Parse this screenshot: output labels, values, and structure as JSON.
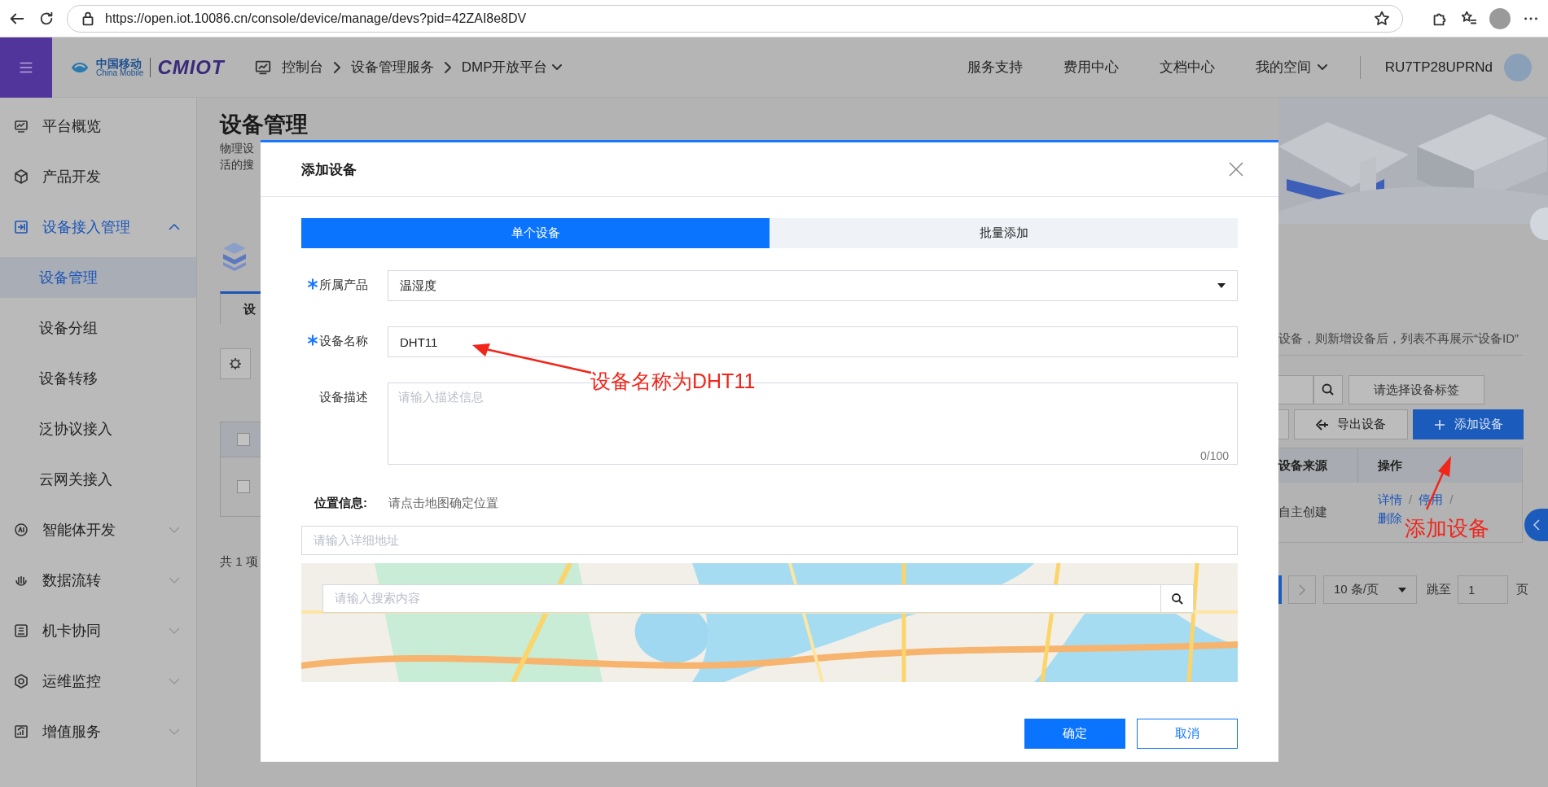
{
  "browser": {
    "url": "https://open.iot.10086.cn/console/device/manage/devs?pid=42ZAI8e8DV"
  },
  "header": {
    "logo": {
      "cn": "中国移动",
      "en": "China Mobile",
      "brand": "CMIOT"
    },
    "breadcrumb": [
      {
        "label": "控制台",
        "dropdown": false
      },
      {
        "label": "设备管理服务",
        "dropdown": false
      },
      {
        "label": "DMP开放平台",
        "dropdown": true
      }
    ],
    "nav": [
      {
        "label": "服务支持",
        "dropdown": false
      },
      {
        "label": "费用中心",
        "dropdown": false
      },
      {
        "label": "文档中心",
        "dropdown": false
      },
      {
        "label": "我的空间",
        "dropdown": true
      }
    ],
    "user": "RU7TP28UPRNd"
  },
  "sidebar": {
    "items": [
      {
        "label": "平台概览",
        "kind": "link",
        "selected": false
      },
      {
        "label": "产品开发",
        "kind": "link",
        "selected": false
      },
      {
        "label": "设备接入管理",
        "kind": "group",
        "selected": true,
        "expanded": true,
        "children": [
          {
            "label": "设备管理",
            "selected": true
          },
          {
            "label": "设备分组",
            "selected": false
          },
          {
            "label": "设备转移",
            "selected": false
          },
          {
            "label": "泛协议接入",
            "selected": false
          },
          {
            "label": "云网关接入",
            "selected": false
          }
        ]
      },
      {
        "label": "智能体开发",
        "kind": "group",
        "selected": false,
        "expanded": false
      },
      {
        "label": "数据流转",
        "kind": "group",
        "selected": false,
        "expanded": false
      },
      {
        "label": "机卡协同",
        "kind": "group",
        "selected": false,
        "expanded": false
      },
      {
        "label": "运维监控",
        "kind": "group",
        "selected": false,
        "expanded": false
      },
      {
        "label": "增值服务",
        "kind": "group",
        "selected": false,
        "expanded": false
      }
    ]
  },
  "page": {
    "title": "设备管理",
    "description": [
      "物理设",
      "活的搜"
    ],
    "tab": "设",
    "notice": "设备，则新增设备后，列表不再展示“设备ID”",
    "tag_button": "请选择设备标签",
    "export_button": "导出设备",
    "add_button": "添加设备",
    "header_checked": false,
    "columns": [
      "设备来源",
      "操作"
    ],
    "rows": [
      {
        "checked": false,
        "source": "自主创建",
        "actions": [
          "详情",
          "停用",
          "删除"
        ],
        "separator": "/"
      }
    ],
    "total": "共 1 项",
    "pagination": {
      "page_size": "10 条/页",
      "jump_label": "跳至",
      "page": "1",
      "page_suffix": "页"
    }
  },
  "dialog": {
    "title": "添加设备",
    "tabs": [
      {
        "label": "单个设备",
        "selected": true
      },
      {
        "label": "批量添加",
        "selected": false
      }
    ],
    "fields": [
      {
        "kind": "select",
        "label": "所属产品",
        "required": true,
        "value": "温湿度"
      },
      {
        "kind": "input",
        "label": "设备名称",
        "required": true,
        "value": "DHT11"
      },
      {
        "kind": "textarea",
        "label": "设备描述",
        "required": false,
        "placeholder": "请输入描述信息",
        "counter": "0/100"
      }
    ],
    "location": {
      "label": "位置信息:",
      "hint": "请点击地图确定位置",
      "address_placeholder": "请输入详细地址",
      "search_placeholder": "请输入搜索内容"
    },
    "buttons": [
      {
        "label": "确定",
        "kind": "primary"
      },
      {
        "label": "取消",
        "kind": "default"
      }
    ]
  },
  "annotations": [
    {
      "text": "设备名称为DHT11"
    },
    {
      "text": "添加设备"
    }
  ]
}
